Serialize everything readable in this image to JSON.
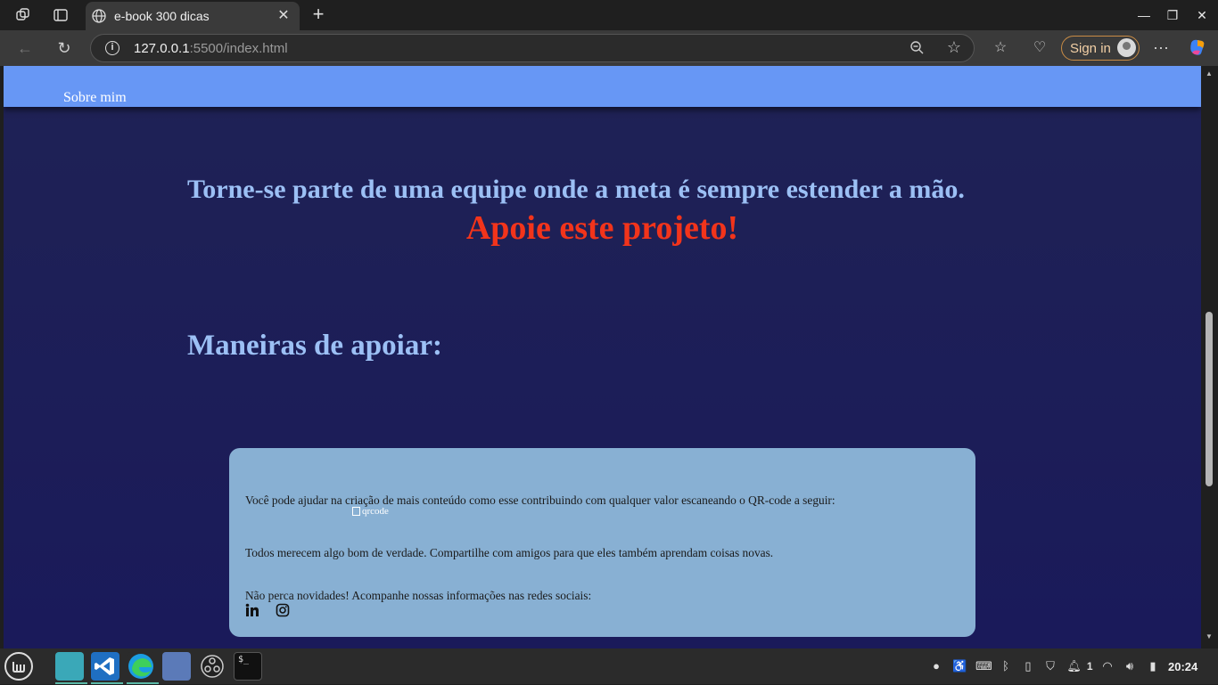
{
  "browser": {
    "tab_title": "e-book 300 dicas",
    "url_host": "127.0.0.1",
    "url_rest": ":5500/index.html",
    "sign_in_label": "Sign in"
  },
  "site": {
    "nav_link": "Sobre mim",
    "headline": "Torne-se parte de uma equipe onde a meta é sempre estender a mão.",
    "call_to_action": "Apoie este projeto!",
    "section_title": "Maneiras de apoiar:",
    "card": {
      "qr_text": "Você pode ajudar na criação de mais conteúdo como esse contribuindo com qualquer valor escaneando o QR-code a seguir:",
      "qr_alt": "qrcode",
      "share_text": "Todos merecem algo bom de verdade. Compartilhe com amigos para que eles também aprendam coisas novas.",
      "social_text": "Não perca novidades! Acompanhe nossas informações nas redes sociais:",
      "social_icons": [
        "linkedin-icon",
        "instagram-icon"
      ]
    }
  },
  "taskbar": {
    "apps": [
      "mint-menu-icon",
      "files-icon",
      "vscode-icon",
      "edge-icon",
      "screenshot-icon",
      "obs-icon",
      "terminal-icon"
    ],
    "notification_count": "1",
    "clock": "20:24"
  },
  "colors": {
    "page_bg": "#1f2255",
    "nav_bg": "#6797f5",
    "headline": "#9cc0f5",
    "cta": "#f2341b",
    "card_bg": "#88b0d3"
  }
}
